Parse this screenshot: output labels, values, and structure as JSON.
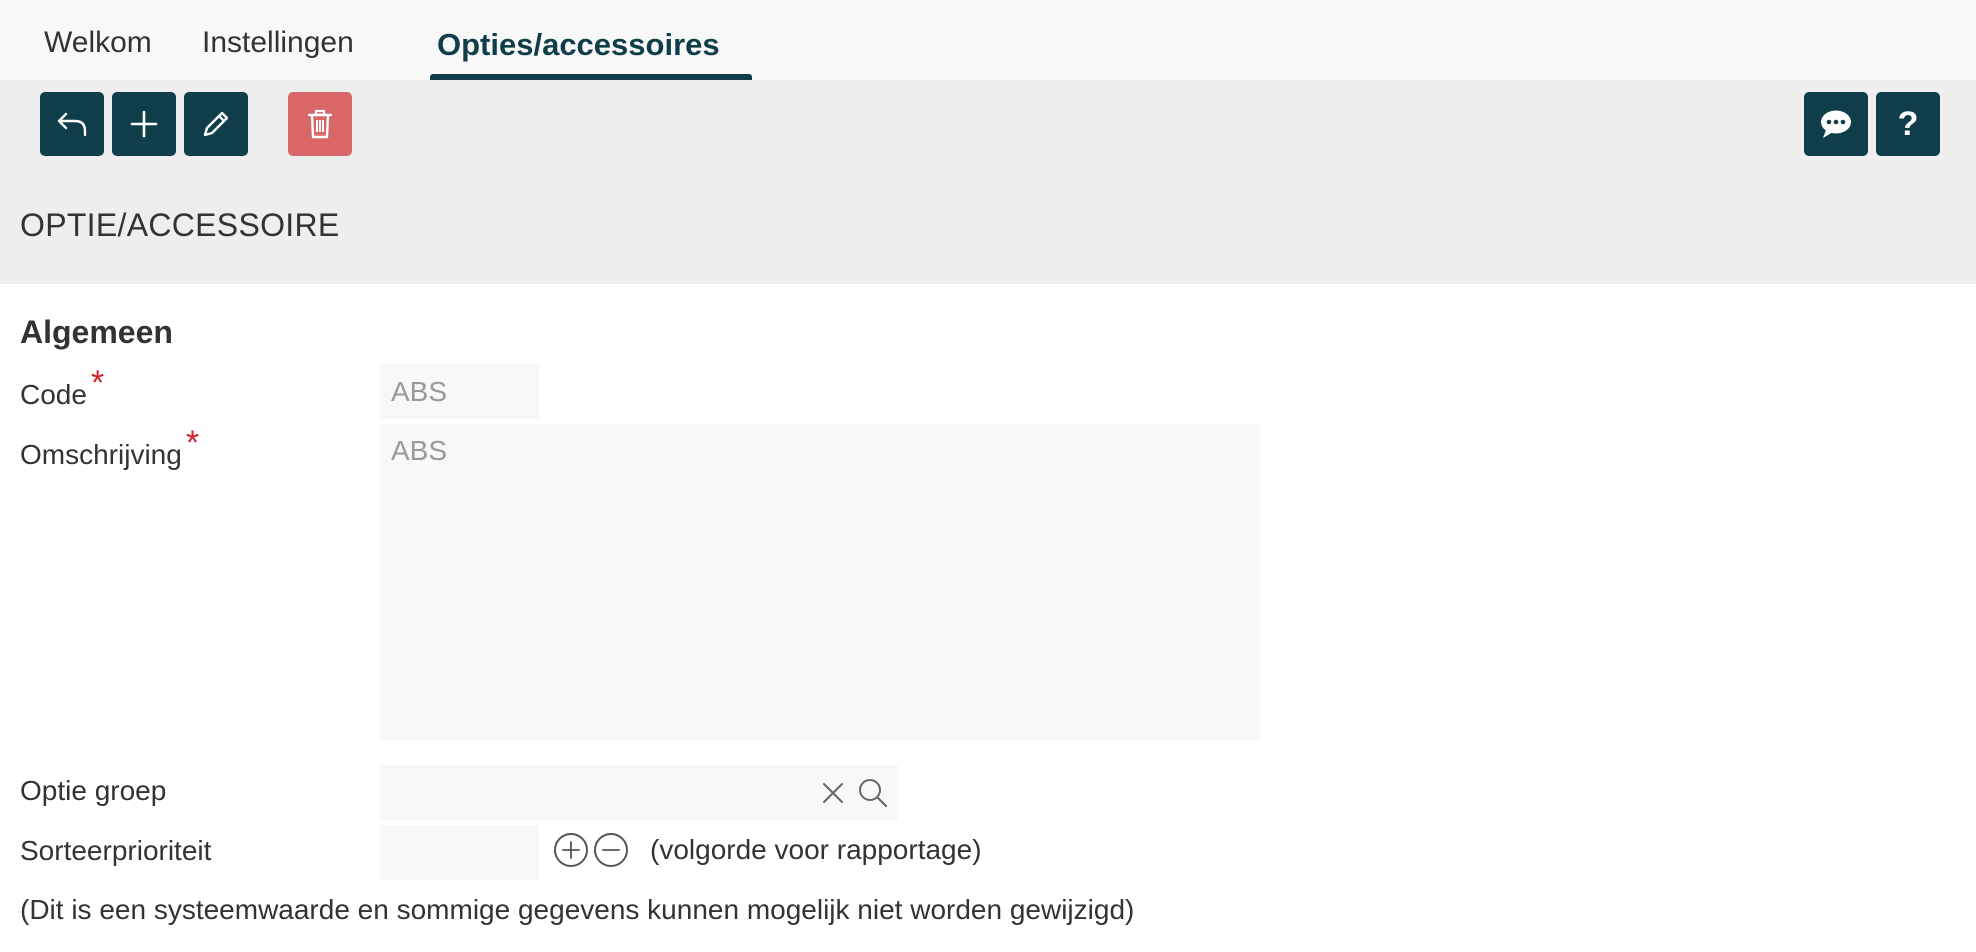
{
  "tabs": [
    {
      "label": "Welkom",
      "active": false
    },
    {
      "label": "Instellingen",
      "active": false
    },
    {
      "label": "Opties/accessoires",
      "active": true
    }
  ],
  "toolbar": {
    "buttons_left": [
      {
        "icon": "undo-arrow-icon"
      },
      {
        "icon": "plus-icon"
      },
      {
        "icon": "pencil-icon"
      },
      {
        "icon": "trash-icon"
      }
    ],
    "buttons_right": [
      {
        "icon": "chat-bubble-icon"
      },
      {
        "icon": "help-icon",
        "label": "?"
      }
    ]
  },
  "page_title": "OPTIE/ACCESSOIRE",
  "section": {
    "title": "Algemeen"
  },
  "fields": {
    "code": {
      "label": "Code",
      "required_mark": "*",
      "value": "ABS"
    },
    "description": {
      "label": "Omschrijving",
      "required_mark": "*",
      "value": "ABS"
    },
    "option_group": {
      "label": "Optie groep",
      "value": ""
    },
    "sort_priority": {
      "label": "Sorteerprioriteit",
      "value": "",
      "hint": "(volgorde voor rapportage)"
    }
  },
  "system_note": "(Dit is een systeemwaarde en sommige gegevens kunnen mogelijk niet worden gewijzigd)",
  "colors": {
    "primary": "#0f3d4a",
    "danger": "#d96767",
    "required": "#d0202a"
  }
}
